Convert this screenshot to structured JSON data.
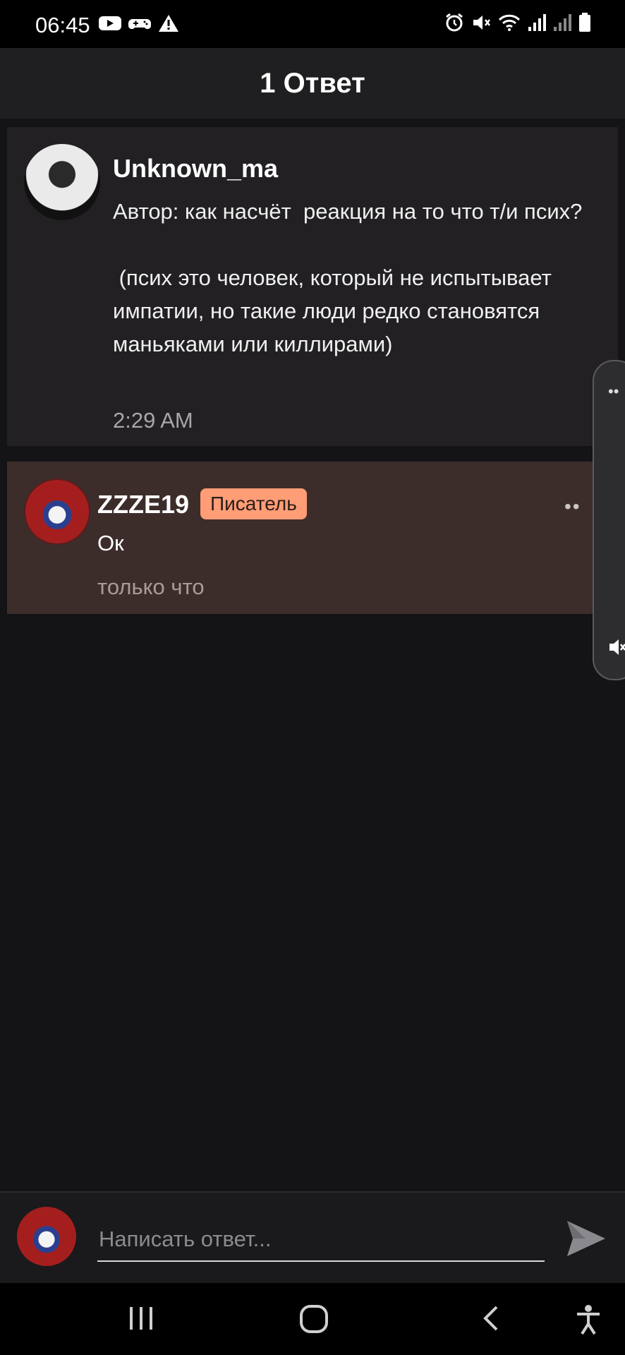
{
  "status_bar": {
    "time": "06:45",
    "left_icons": [
      "youtube-icon",
      "gamepad-icon",
      "warning-icon"
    ],
    "right_icons": [
      "alarm-icon",
      "mute-icon",
      "wifi-icon",
      "signal-icon",
      "signal-icon",
      "battery-icon"
    ]
  },
  "header": {
    "title": "1 Ответ"
  },
  "post": {
    "author": "Unknown_ma",
    "text": "Автор: как насчёт  реакция на то что т/и псих?\n\n (псих это человек, который не испытывает импатии, но такие люди редко становятся маньяками или киллирами)",
    "time": "2:29 AM"
  },
  "reply": {
    "author": "ZZZE19",
    "badge": "Писатель",
    "more": "••",
    "text": "Ок",
    "time": "только что"
  },
  "side_panel": {
    "dots": "••"
  },
  "composer": {
    "placeholder": "Написать ответ..."
  },
  "nav": {
    "items": [
      "recents-icon",
      "home-icon",
      "back-icon",
      "accessibility-icon"
    ]
  },
  "colors": {
    "background": "#141315",
    "badge": "#ff9d76",
    "reply_bg": "#3c2d2b",
    "post_bg": "#222023"
  }
}
